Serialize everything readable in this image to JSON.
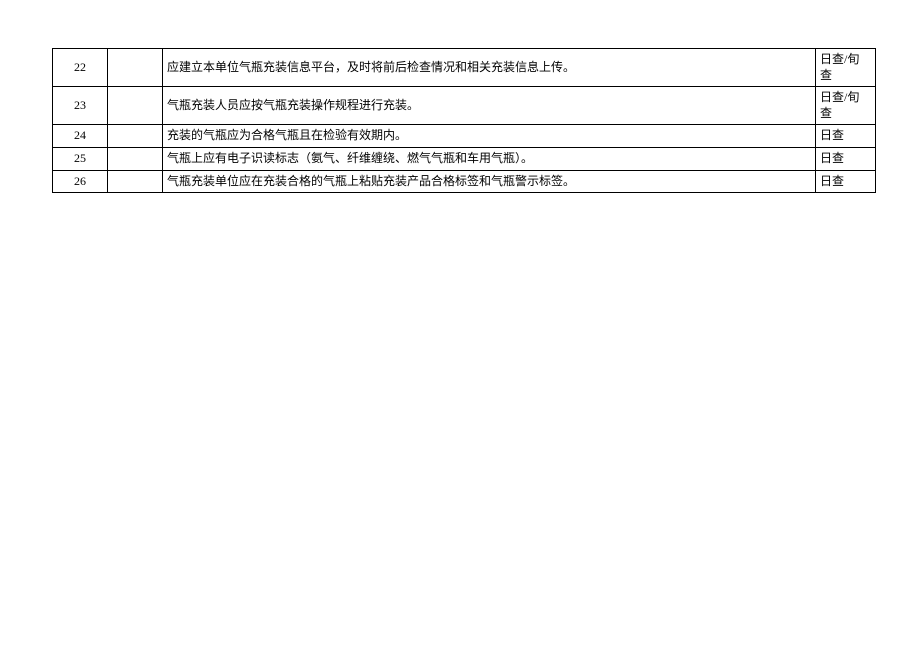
{
  "rows": [
    {
      "num": "22",
      "desc": "应建立本单位气瓶充装信息平台，及时将前后检查情况和相关充装信息上传。",
      "freq": "日查/旬查"
    },
    {
      "num": "23",
      "desc": "气瓶充装人员应按气瓶充装操作规程进行充装。",
      "freq": "日查/旬查"
    },
    {
      "num": "24",
      "desc": "充装的气瓶应为合格气瓶且在检验有效期内。",
      "freq": "日查"
    },
    {
      "num": "25",
      "desc": "气瓶上应有电子识读标志（氨气、纤维缠绕、燃气气瓶和车用气瓶）。",
      "freq": "日查"
    },
    {
      "num": "26",
      "desc": "气瓶充装单位应在充装合格的气瓶上粘贴充装产品合格标签和气瓶警示标签。",
      "freq": "日查"
    }
  ]
}
